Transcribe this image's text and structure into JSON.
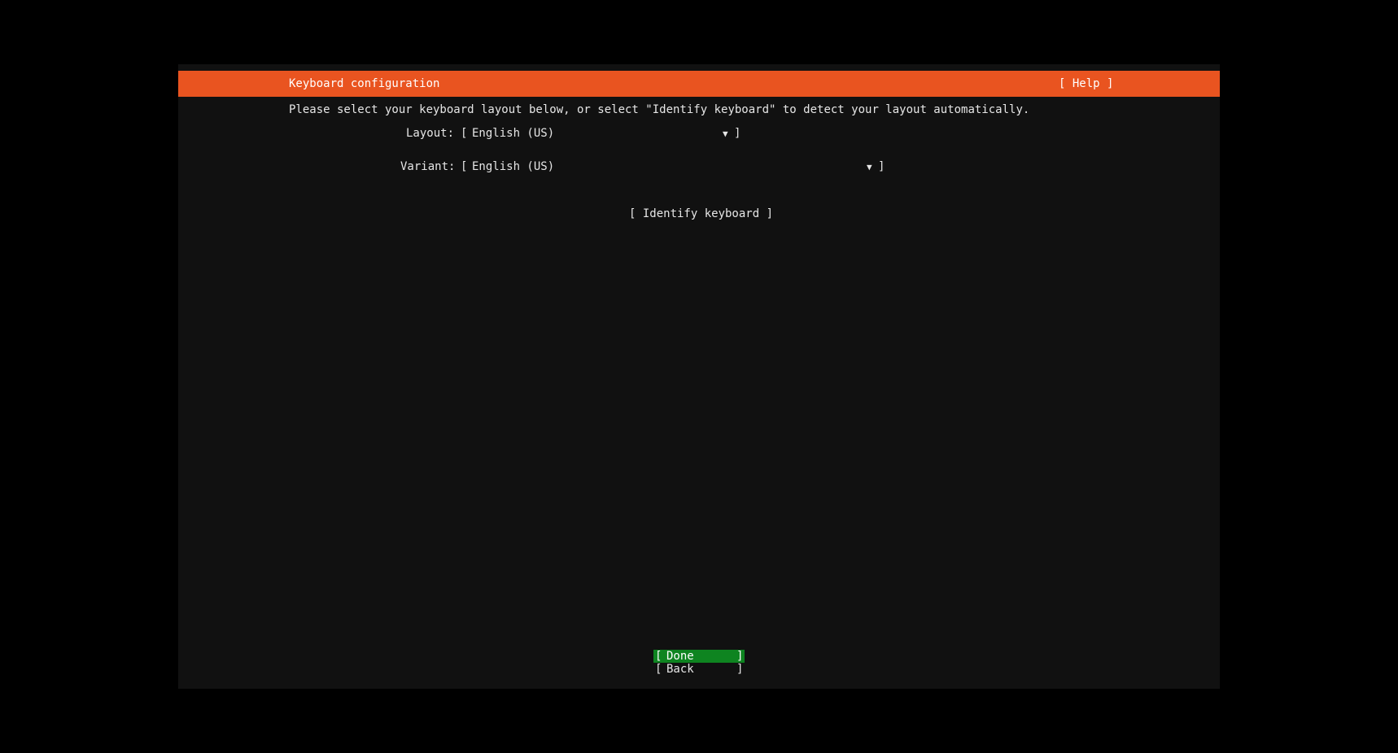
{
  "header": {
    "title": "Keyboard configuration",
    "help_label": "[ Help ]"
  },
  "instruction": "Please select your keyboard layout below, or select \"Identify keyboard\" to detect your layout automatically.",
  "layout": {
    "label": "Layout:",
    "value": "English (US)"
  },
  "variant": {
    "label": "Variant:",
    "value": "English (US)"
  },
  "identify_button": "[ Identify keyboard ]",
  "buttons": {
    "done": "Done",
    "back": "Back"
  },
  "glyphs": {
    "open_bracket": "[",
    "close_bracket": "]",
    "dropdown_arrow": "▼"
  },
  "colors": {
    "header_bg": "#e95420",
    "screen_bg": "#111111",
    "focused_button_bg": "#0e8420"
  }
}
